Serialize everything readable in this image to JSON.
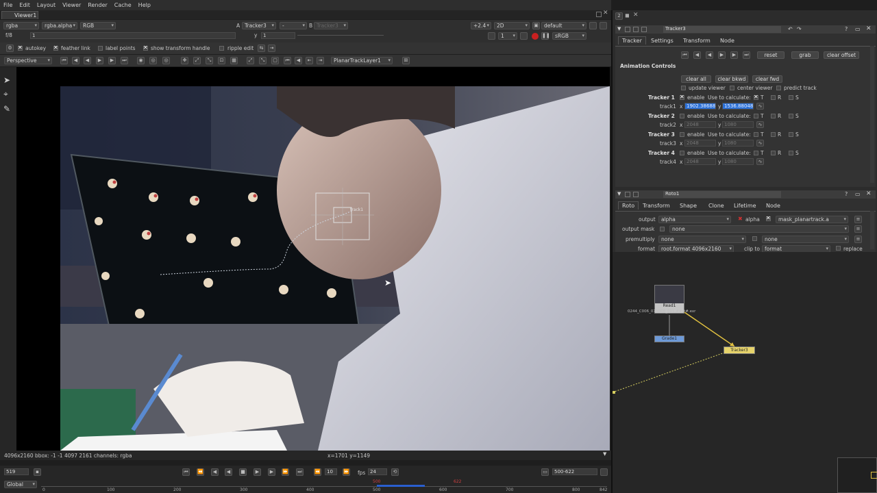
{
  "menu": [
    "File",
    "Edit",
    "Layout",
    "Viewer",
    "Render",
    "Cache",
    "Help"
  ],
  "viewer_tab": "Viewer1",
  "viewer_toolbar": {
    "channels": "rgba",
    "alpha": "rgba.alpha",
    "colorspace": "RGB",
    "a_label": "A",
    "a_input": "Tracker3",
    "a_op": "-",
    "b_label": "B",
    "b_input": "Tracker3",
    "gain": "+2.4",
    "view_mode": "2D",
    "proxy": "default",
    "fstop": "f/8",
    "frame_in": "1",
    "y_label": "y",
    "y_val": "1",
    "scale": "1",
    "lut": "sRGB"
  },
  "tracker_toolbar": {
    "autokey": "autokey",
    "feather_link": "feather link",
    "label_points": "label points",
    "show_transform_handle": "show transform handle",
    "ripple_edit": "ripple edit"
  },
  "viewer_toolbar2": {
    "projection": "Perspective",
    "layer": "PlanarTrackLayer1"
  },
  "overlay": {
    "track_label": "track1"
  },
  "status": {
    "info": "4096x2160 bbox: -1 -1 4097 2161 channels: rgba",
    "coords": "x=1701 y=1149"
  },
  "timeline": {
    "current_frame": "519",
    "fps_label": "fps",
    "fps": "24",
    "range": "500-622",
    "step": "10",
    "scope": "Global",
    "ticks": [
      "0",
      "100",
      "200",
      "300",
      "400",
      "500",
      "600",
      "700",
      "800",
      "842"
    ],
    "in_marker": "500",
    "out_marker": "622"
  },
  "tracker_panel": {
    "node_name": "Tracker3",
    "tabs": [
      "Tracker",
      "Settings",
      "Transform",
      "Node"
    ],
    "reset": "reset",
    "grab": "grab",
    "clear_offset": "clear offset",
    "animation_controls": "Animation Controls",
    "clear_all": "clear all",
    "clear_bkwd": "clear bkwd",
    "clear_fwd": "clear fwd",
    "update_viewer": "update viewer",
    "center_viewer": "center viewer",
    "predict_track": "predict track",
    "trackers": [
      {
        "name": "Tracker 1",
        "enable": "enable",
        "use": "Use to calculate:",
        "track": "track1",
        "x": "1902.38688",
        "y": "1536.88048",
        "T": "T",
        "R": "R",
        "S": "S"
      },
      {
        "name": "Tracker 2",
        "enable": "enable",
        "use": "Use to calculate:",
        "track": "track2",
        "x": "2048",
        "y": "1080",
        "T": "T",
        "R": "R",
        "S": "S"
      },
      {
        "name": "Tracker 3",
        "enable": "enable",
        "use": "Use to calculate:",
        "track": "track3",
        "x": "2048",
        "y": "1080",
        "T": "T",
        "R": "R",
        "S": "S"
      },
      {
        "name": "Tracker 4",
        "enable": "enable",
        "use": "Use to calculate:",
        "track": "track4",
        "x": "2048",
        "y": "1080",
        "T": "T",
        "R": "R",
        "S": "S"
      }
    ]
  },
  "roto_panel": {
    "node_name": "Roto1",
    "tabs": [
      "Roto",
      "Transform",
      "Shape",
      "Clone",
      "Lifetime",
      "Node"
    ],
    "output_label": "output",
    "output_val": "alpha",
    "alpha_label": "alpha",
    "mask_val": "mask_planartrack.a",
    "output_mask_label": "output mask",
    "output_mask_val": "none",
    "premultiply_label": "premultiply",
    "premultiply_val": "none",
    "premult_right": "none",
    "format_label": "format",
    "format_val": "root.format 4096x2160",
    "clip_label": "clip to",
    "clip_val": "format",
    "replace_label": "replace"
  },
  "nodes": {
    "read": "Read1",
    "read_file": "0244_C006_0130RB_001.####.exr",
    "grade": "Grade1",
    "tracker": "Tracker3"
  },
  "colors": {
    "selection_blue": "#2a6fd6",
    "tracker_node": "#e6d36b",
    "grade_node": "#6d9ad8",
    "red_dot": "#d03030"
  }
}
